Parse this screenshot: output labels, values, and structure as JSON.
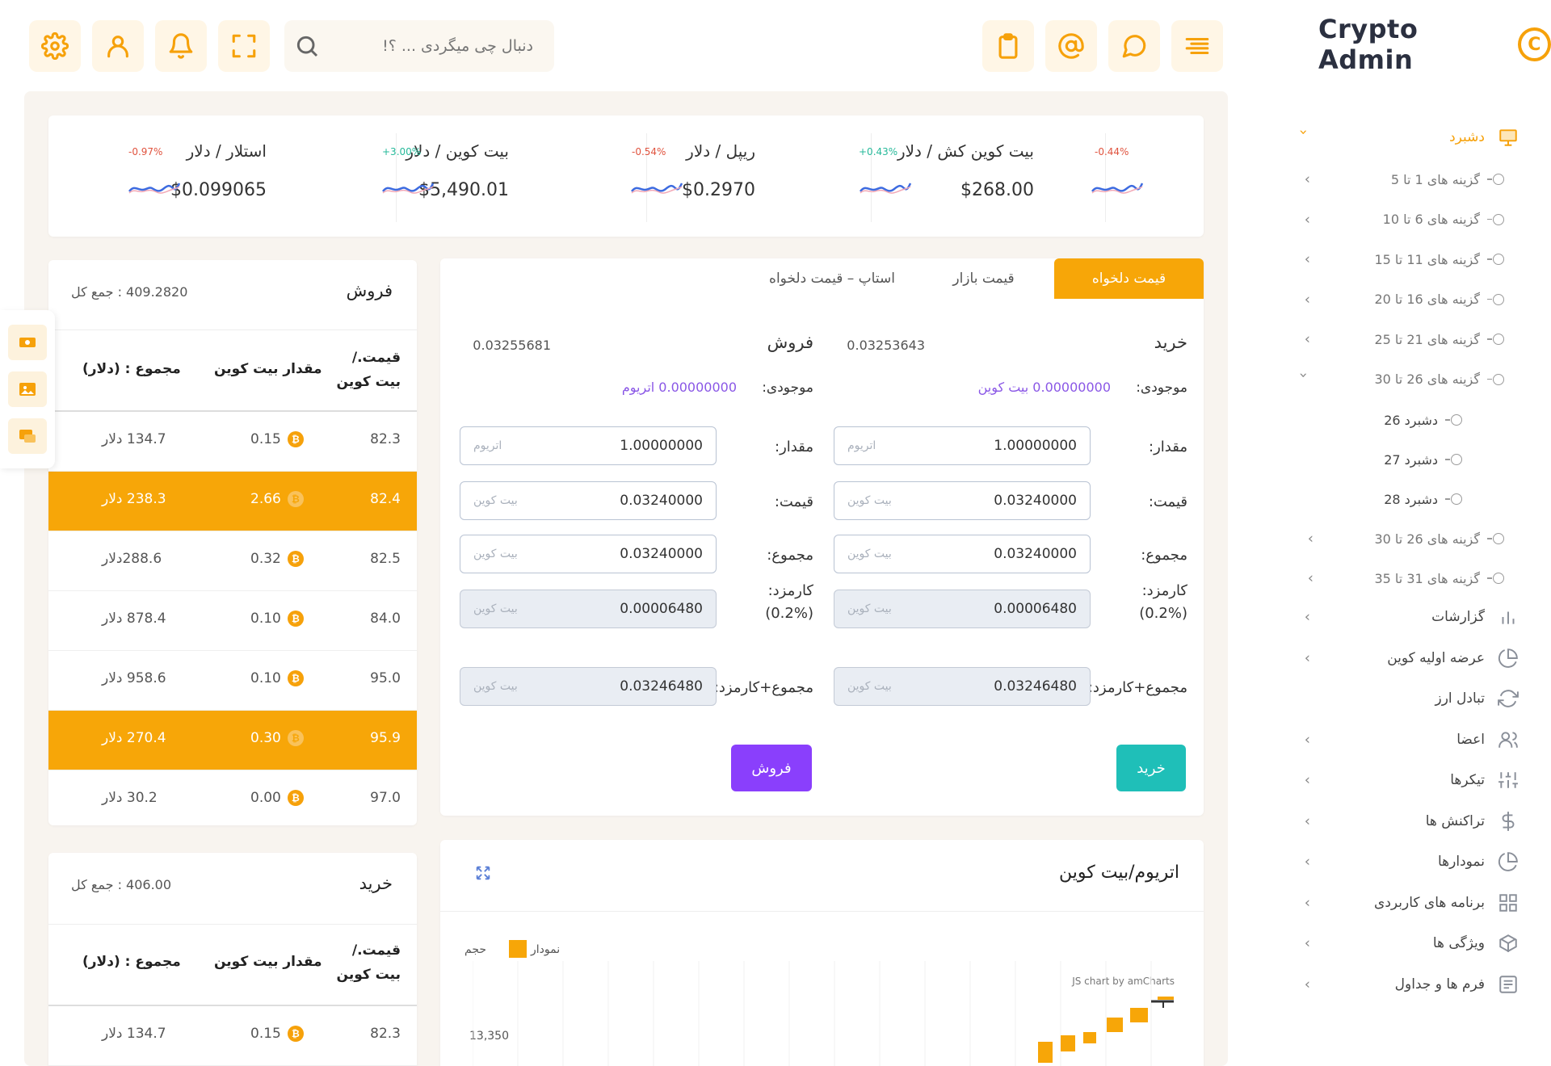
{
  "app": {
    "title": "Crypto Admin",
    "logo_mark": "C"
  },
  "header": {
    "search_placeholder": "دنبال چی میگردی ... ؟!"
  },
  "tickers": [
    {
      "name": "بیت کوین کش / دلار",
      "price": "$268.00",
      "change": "-0.44%",
      "change_color": "#e0533e"
    },
    {
      "name": "ریپل / دلار",
      "price": "$0.2970",
      "change": "+0.43%",
      "change_color": "#26b99a"
    },
    {
      "name": "بیت کوین / دلار",
      "price": "$5,490.01",
      "change": "-0.54%",
      "change_color": "#e0533e"
    },
    {
      "name": "استلار / دلار",
      "price": "$0.099065",
      "change": "+3.00%",
      "change_color": "#26b99a"
    },
    {
      "name": "",
      "price": "",
      "change": "-0.97%",
      "change_color": "#e0533e"
    }
  ],
  "sell_book": {
    "title": "فروش",
    "total": "409.2820 : جمع کل",
    "headers": [
      "قیمت./ بیت کوین",
      "مقدار بیت کوین",
      "مجموع : (دلار)"
    ],
    "rows": [
      {
        "price": "82.3",
        "amount": "0.15",
        "total": "134.7 دلار",
        "highlight": false
      },
      {
        "price": "82.4",
        "amount": "2.66",
        "total": "238.3 دلار",
        "highlight": true
      },
      {
        "price": "82.5",
        "amount": "0.32",
        "total": "288.6دلار",
        "highlight": false
      },
      {
        "price": "84.0",
        "amount": "0.10",
        "total": "878.4 دلار",
        "highlight": false
      },
      {
        "price": "95.0",
        "amount": "0.10",
        "total": "958.6 دلار",
        "highlight": false
      },
      {
        "price": "95.9",
        "amount": "0.30",
        "total": "270.4 دلار",
        "highlight": true
      },
      {
        "price": "97.0",
        "amount": "0.00",
        "total": "30.2 دلار",
        "highlight": false
      }
    ]
  },
  "buy_book": {
    "title": "خرید",
    "total": "406.00 : جمع کل",
    "headers": [
      "قیمت./ بیت کوین",
      "مقدار بیت کوین",
      "مجموع : (دلار)"
    ],
    "rows": [
      {
        "price": "82.3",
        "amount": "0.15",
        "total": "134.7 دلار",
        "highlight": false
      }
    ]
  },
  "trade": {
    "tabs": [
      "قیمت دلخواه",
      "قیمت بازار",
      "استاپ – قیمت دلخواه"
    ],
    "buy": {
      "title": "خرید",
      "rate": "0.03253643",
      "available_label": "موجودی:",
      "available_value": "0.00000000 بیت کوین",
      "fields": [
        {
          "label": "مقدار:",
          "value": "1.00000000",
          "unit": "اتریوم",
          "readonly": false
        },
        {
          "label": "قیمت:",
          "value": "0.03240000",
          "unit": "بیت کوین",
          "readonly": false
        },
        {
          "label": "مجموع:",
          "value": "0.03240000",
          "unit": "بیت کوین",
          "readonly": false
        },
        {
          "label": "کارمزد: (%0.2)",
          "value": "0.00006480",
          "unit": "بیت کوین",
          "readonly": true
        },
        {
          "label": "مجموع+کارمزد:",
          "value": "0.03246480",
          "unit": "بیت کوین",
          "readonly": true
        }
      ],
      "button": "خرید",
      "button_color": "#1fbfb8"
    },
    "sell": {
      "title": "فروش",
      "rate": "0.03255681",
      "available_label": "موجودی:",
      "available_value": "0.00000000 اتریوم",
      "fields": [
        {
          "label": "مقدار:",
          "value": "1.00000000",
          "unit": "اتریوم",
          "readonly": false
        },
        {
          "label": "قیمت:",
          "value": "0.03240000",
          "unit": "بیت کوین",
          "readonly": false
        },
        {
          "label": "مجموع:",
          "value": "0.03240000",
          "unit": "بیت کوین",
          "readonly": false
        },
        {
          "label": "کارمزد: (%0.2)",
          "value": "0.00006480",
          "unit": "بیت کوین",
          "readonly": true
        },
        {
          "label": "مجموع+کارمزد:",
          "value": "0.03246480",
          "unit": "بیت کوین",
          "readonly": true
        }
      ],
      "button": "فروش",
      "button_color": "#8a3ffc"
    }
  },
  "chart": {
    "title": "اتریوم/بیت کوین",
    "legend_series": "نمودار",
    "legend_volume": "حجم",
    "credit": "JS chart by amCharts",
    "y_tick": "13,350"
  },
  "sidebar": {
    "dashboard": "دشبرد",
    "sub_items": [
      "گزینه های 1 تا 5",
      "گزینه های 6 تا 10",
      "گزینه های 11 تا 15",
      "گزینه های 16 تا 20",
      "گزینه های 21 تا 25",
      "گزینه های 26 تا 30"
    ],
    "sub_sub_items": [
      "دشبرد 26",
      "دشبرد 27",
      "دشبرد 28"
    ],
    "sub_items_after": [
      "گزینه های 26 تا 30",
      "گزینه های 31 تا 35"
    ],
    "menu": [
      {
        "label": "گزارشات",
        "icon": "bar-chart-icon"
      },
      {
        "label": "عرضه اولیه کوین",
        "icon": "pie-chart-icon"
      },
      {
        "label": "تبادل ارز",
        "icon": "refresh-icon"
      },
      {
        "label": "اعضا",
        "icon": "users-icon"
      },
      {
        "label": "تیکرها",
        "icon": "sliders-icon"
      },
      {
        "label": "تراکنش ها",
        "icon": "dollar-icon"
      },
      {
        "label": "نمودارها",
        "icon": "pie-chart-icon"
      },
      {
        "label": "برنامه های کاربردی",
        "icon": "grid-icon"
      },
      {
        "label": "ویژگی ها",
        "icon": "box-icon"
      },
      {
        "label": "فرم ها و جداول",
        "icon": "form-icon"
      }
    ]
  },
  "colors": {
    "accent": "#f7a608",
    "accent_light": "#fff6e6",
    "buy": "#1fbfb8",
    "sell": "#8a3ffc",
    "link": "#8a57e6"
  }
}
